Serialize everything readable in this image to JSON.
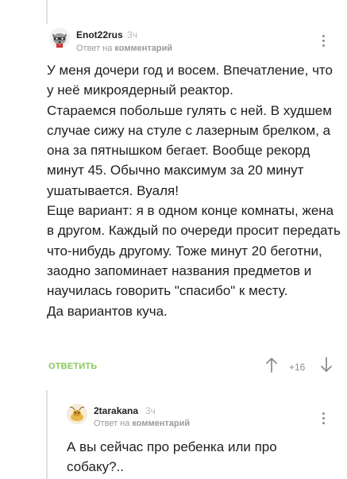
{
  "comments": [
    {
      "author": "Enot22rus",
      "time": "3ч",
      "reply_prefix": "Ответ на",
      "reply_target": "комментарий",
      "paragraphs": [
        "У меня дочери год и восем. Впечатление, что у неё микроядерный реактор.",
        "Стараемся побольше гулять с ней. В худшем случае сижу на стуле с лазерным брелком, а она за пятнышком бегает. Вообще рекорд минут 45. Обычно максимум за 20 минут ушатывается. Вуаля!",
        "Еще вариант: я в одном конце комнаты, жена в другом. Каждый по очереди просит передать что-нибудь другому. Тоже минут 20 беготни, заодно запоминает названия предметов и научилась говорить \"спасибо\" к месту.",
        "Да вариантов куча."
      ],
      "reply_label": "ОТВЕТИТЬ",
      "rating": "+16",
      "avatar_icon": "raccoon-avatar-icon"
    },
    {
      "author": "2tarakana",
      "time": "3ч",
      "reply_prefix": "Ответ на",
      "reply_target": "комментарий",
      "paragraphs": [
        "А вы сейчас про ребенка или про собаку?.."
      ],
      "avatar_icon": "cockroach-avatar-icon"
    }
  ],
  "colors": {
    "accent_green": "#8ac858",
    "thread_line": "#e0e0e0",
    "muted_text": "#9a9a9a"
  }
}
